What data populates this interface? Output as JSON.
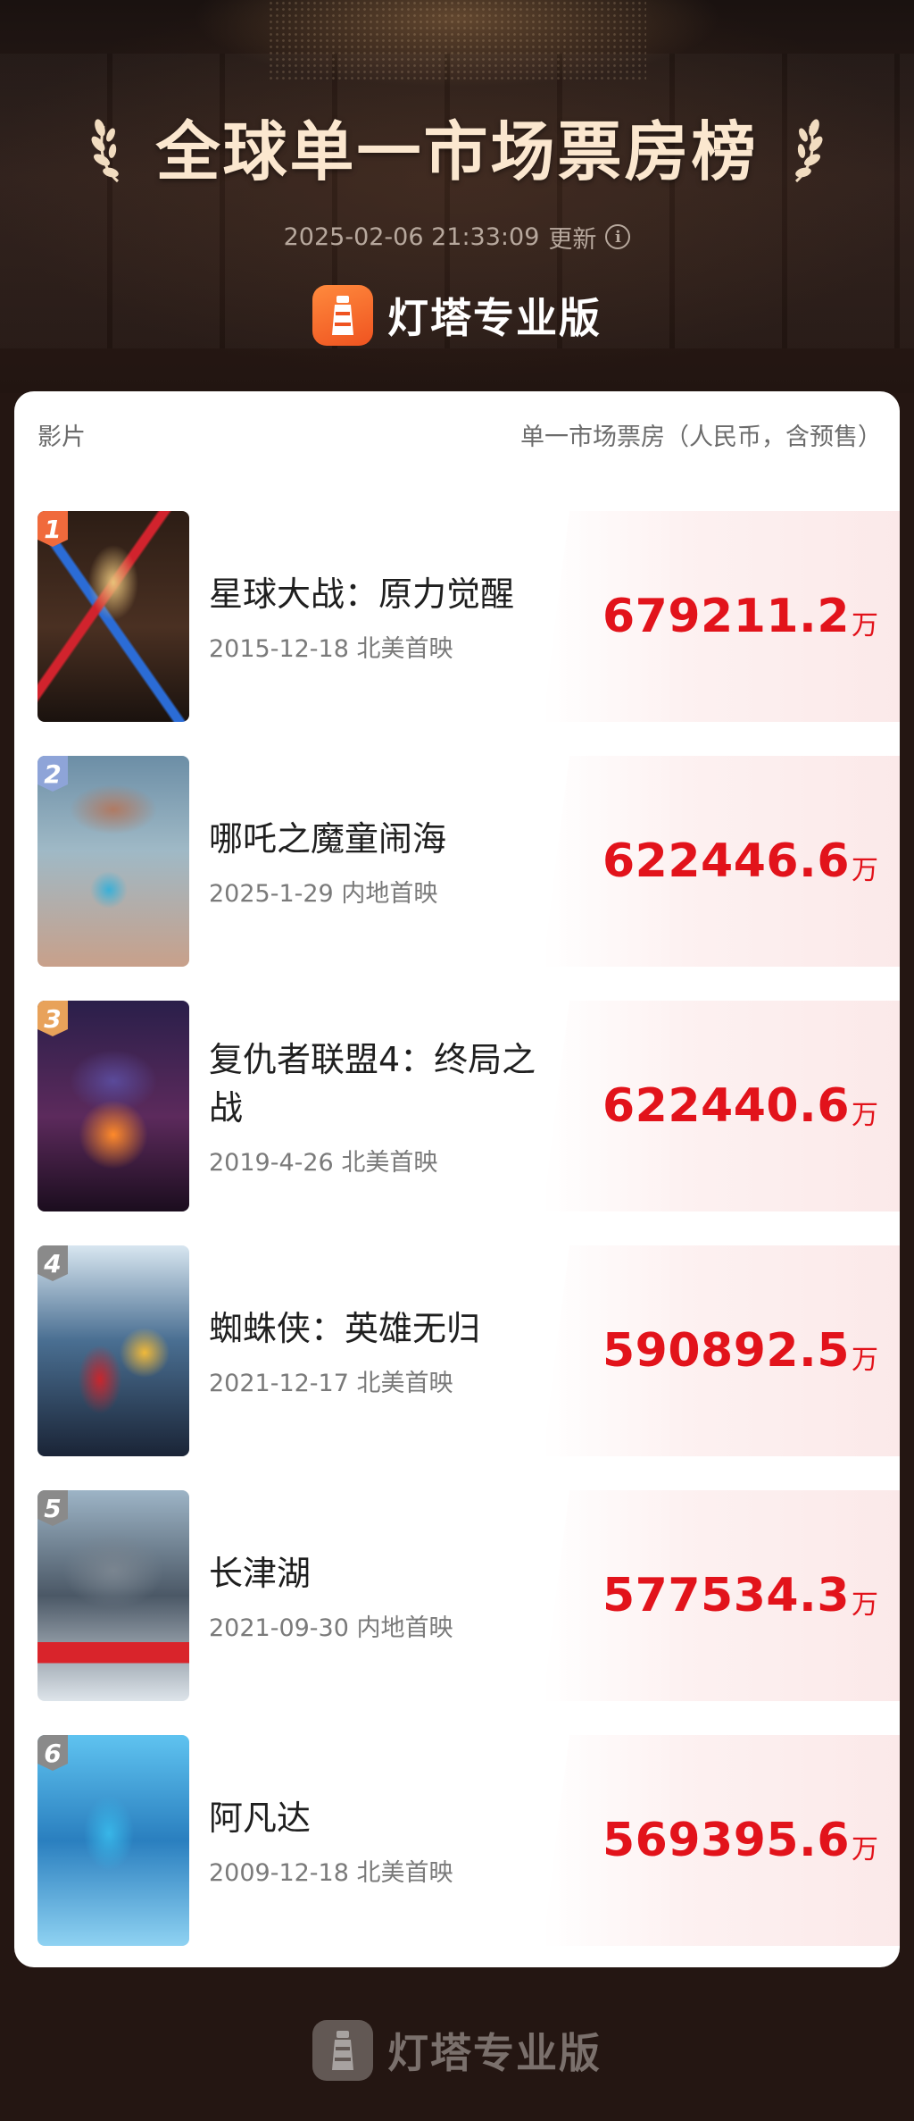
{
  "header": {
    "title": "全球单一市场票房榜",
    "updated_time": "2025-02-06 21:33:09",
    "updated_label": "更新",
    "brand_name": "灯塔专业版"
  },
  "table": {
    "col_film": "影片",
    "col_box_office": "单一市场票房（人民币，含预售）",
    "unit": "万",
    "rows": [
      {
        "rank": "1",
        "title": "星球大战：原力觉醒",
        "release": "2015-12-18 北美首映",
        "box_office": "679211.2"
      },
      {
        "rank": "2",
        "title": "哪吒之魔童闹海",
        "release": "2025-1-29 内地首映",
        "box_office": "622446.6"
      },
      {
        "rank": "3",
        "title": "复仇者联盟4：终局之战",
        "release": "2019-4-26 北美首映",
        "box_office": "622440.6"
      },
      {
        "rank": "4",
        "title": "蜘蛛侠：英雄无归",
        "release": "2021-12-17 北美首映",
        "box_office": "590892.5"
      },
      {
        "rank": "5",
        "title": "长津湖",
        "release": "2021-09-30 内地首映",
        "box_office": "577534.3"
      },
      {
        "rank": "6",
        "title": "阿凡达",
        "release": "2009-12-18 北美首映",
        "box_office": "569395.6"
      }
    ]
  },
  "footer": {
    "brand_name": "灯塔专业版"
  },
  "colors": {
    "title": "#fbe7cf",
    "box_office": "#e2131b",
    "rank1": "#f06a3c",
    "rank2": "#8ea4d8",
    "rank3": "#e8a25a",
    "rank_other": "#8a8a8a"
  }
}
